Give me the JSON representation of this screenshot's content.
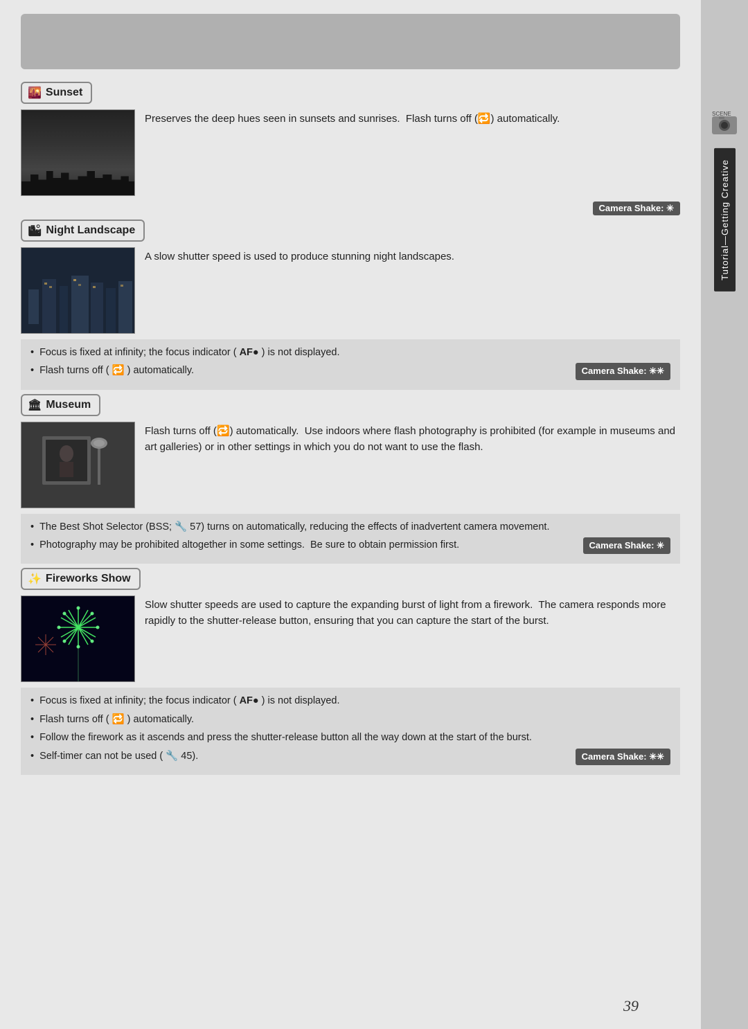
{
  "top_bar": {
    "label": "gray_bar"
  },
  "sections": {
    "sunset": {
      "label": "Sunset",
      "icon": "🌇",
      "description": "Preserves the deep hues seen in sunsets and sunrises.  Flash turns off (🔄) automatically.",
      "camera_shake": "Camera Shake: ✳",
      "bullets": []
    },
    "night_landscape": {
      "label": "Night Landscape",
      "icon": "🏙",
      "description": "A slow shutter speed is used to produce stunning night landscapes.",
      "bullets": [
        "Focus is fixed at infinity; the focus indicator (AF●) is not displayed.",
        "Flash turns off (🔄) automatically."
      ],
      "camera_shake": "Camera Shake: ✳✳"
    },
    "museum": {
      "label": "Museum",
      "icon": "🏛",
      "description": "Flash turns off (🔄) automatically.  Use indoors where flash photography is prohibited (for example in museums and art galleries) or in other settings in which you do not want to use the flash.",
      "bullets": [
        "The Best Shot Selector (BSS; 🔧 57) turns on automatically, reducing the effects of inadvertent camera movement.",
        "Photography may be prohibited altogether in some settings.  Be sure to obtain permission first."
      ],
      "camera_shake": "Camera Shake: ✳"
    },
    "fireworks": {
      "label": "Fireworks Show",
      "icon": "✨",
      "description": "Slow shutter speeds are used to capture the expanding burst of light from a firework.  The camera responds more rapidly to the shutter-release button, ensuring that you can capture the start of the burst.",
      "bullets": [
        "Focus is fixed at infinity; the focus indicator (AF●) is not displayed.",
        "Flash turns off (🔄) automatically.",
        "Follow the firework as it ascends and press the shutter-release button all the way down at the start of the burst.",
        "Self-timer can not be used (🔧 45)."
      ],
      "camera_shake": "Camera Shake: ✳✳"
    }
  },
  "sidebar": {
    "label": "Tutorial—Getting Creative"
  },
  "page_number": "39"
}
